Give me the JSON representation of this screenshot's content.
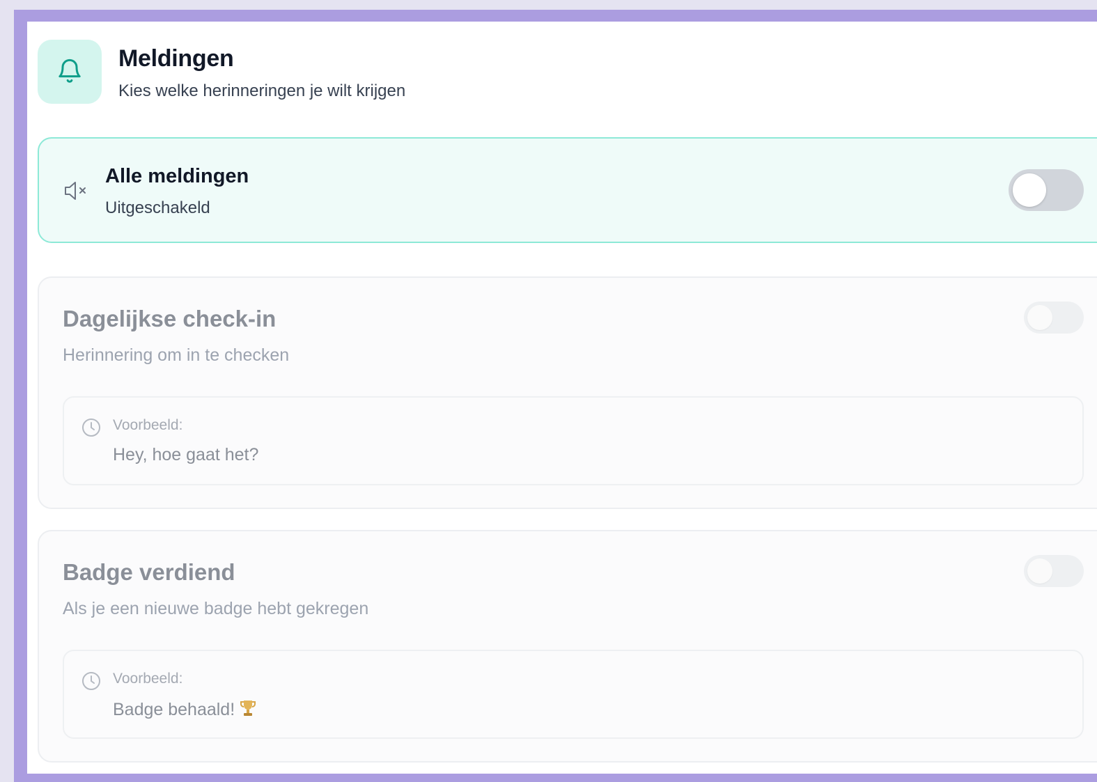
{
  "header": {
    "icon": "bell-icon",
    "title": "Meldingen",
    "subtitle": "Kies welke herinneringen je wilt krijgen"
  },
  "master": {
    "icon": "speaker-muted-icon",
    "title": "Alle meldingen",
    "status": "Uitgeschakeld",
    "enabled": false
  },
  "notifications": [
    {
      "title": "Dagelijkse check-in",
      "description": "Herinnering om in te checken",
      "example_label": "Voorbeeld:",
      "example_text": "Hey, hoe gaat het?",
      "enabled": false
    },
    {
      "title": "Badge verdiend",
      "description": "Als je een nieuwe badge hebt gekregen",
      "example_label": "Voorbeeld:",
      "example_text": "Badge behaald!",
      "example_icon": "trophy-icon",
      "enabled": false
    }
  ],
  "colors": {
    "accent": "#14b8a6",
    "accent_bg": "#d4f5ee",
    "frame": "#ab9de0"
  }
}
